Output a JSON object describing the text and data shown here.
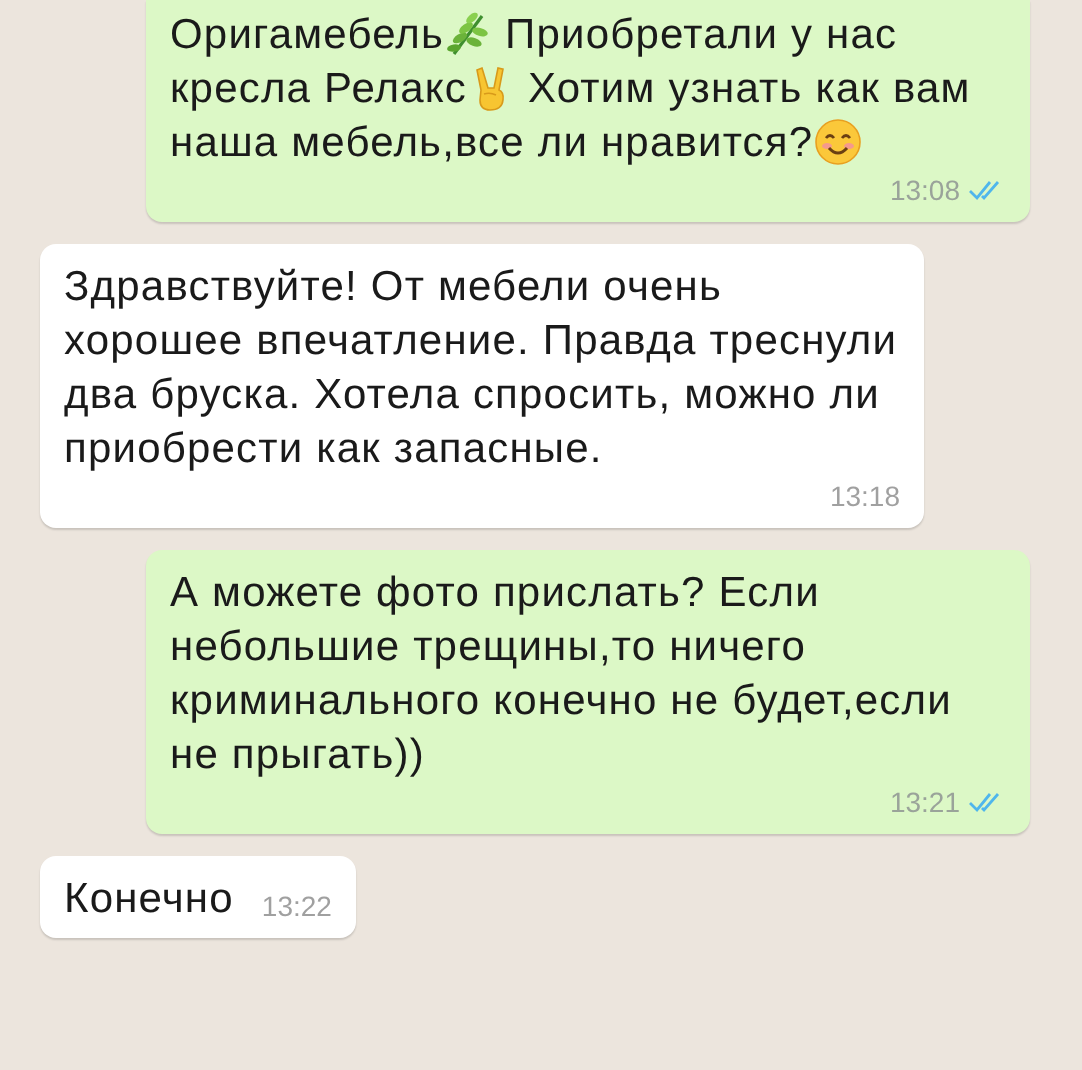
{
  "messages": [
    {
      "kind": "outgoing",
      "parts": [
        {
          "kind": "text",
          "text": "Оригамебель"
        },
        {
          "kind": "herb"
        },
        {
          "kind": "text",
          "text": " Приобретали у нас кресла Релакс"
        },
        {
          "kind": "victory"
        },
        {
          "kind": "text",
          "text": " Хотим узнать как вам наша мебель,все ли нравится?"
        },
        {
          "kind": "smile"
        }
      ],
      "time": "13:08",
      "read": true
    },
    {
      "kind": "incoming",
      "parts": [
        {
          "kind": "text",
          "text": "Здравствуйте! От мебели очень хорошее впечатление. Правда треснули два бруска. Хотела спросить, можно ли приобрести как запасные."
        }
      ],
      "time": "13:18"
    },
    {
      "kind": "outgoing",
      "parts": [
        {
          "kind": "text",
          "text": "А можете фото прислать? Если небольшие трещины,то ничего криминального конечно не будет,если не прыгать))"
        }
      ],
      "time": "13:21",
      "read": true
    },
    {
      "kind": "incoming",
      "parts": [
        {
          "kind": "text",
          "text": "Конечно"
        }
      ],
      "time": "13:22"
    }
  ]
}
